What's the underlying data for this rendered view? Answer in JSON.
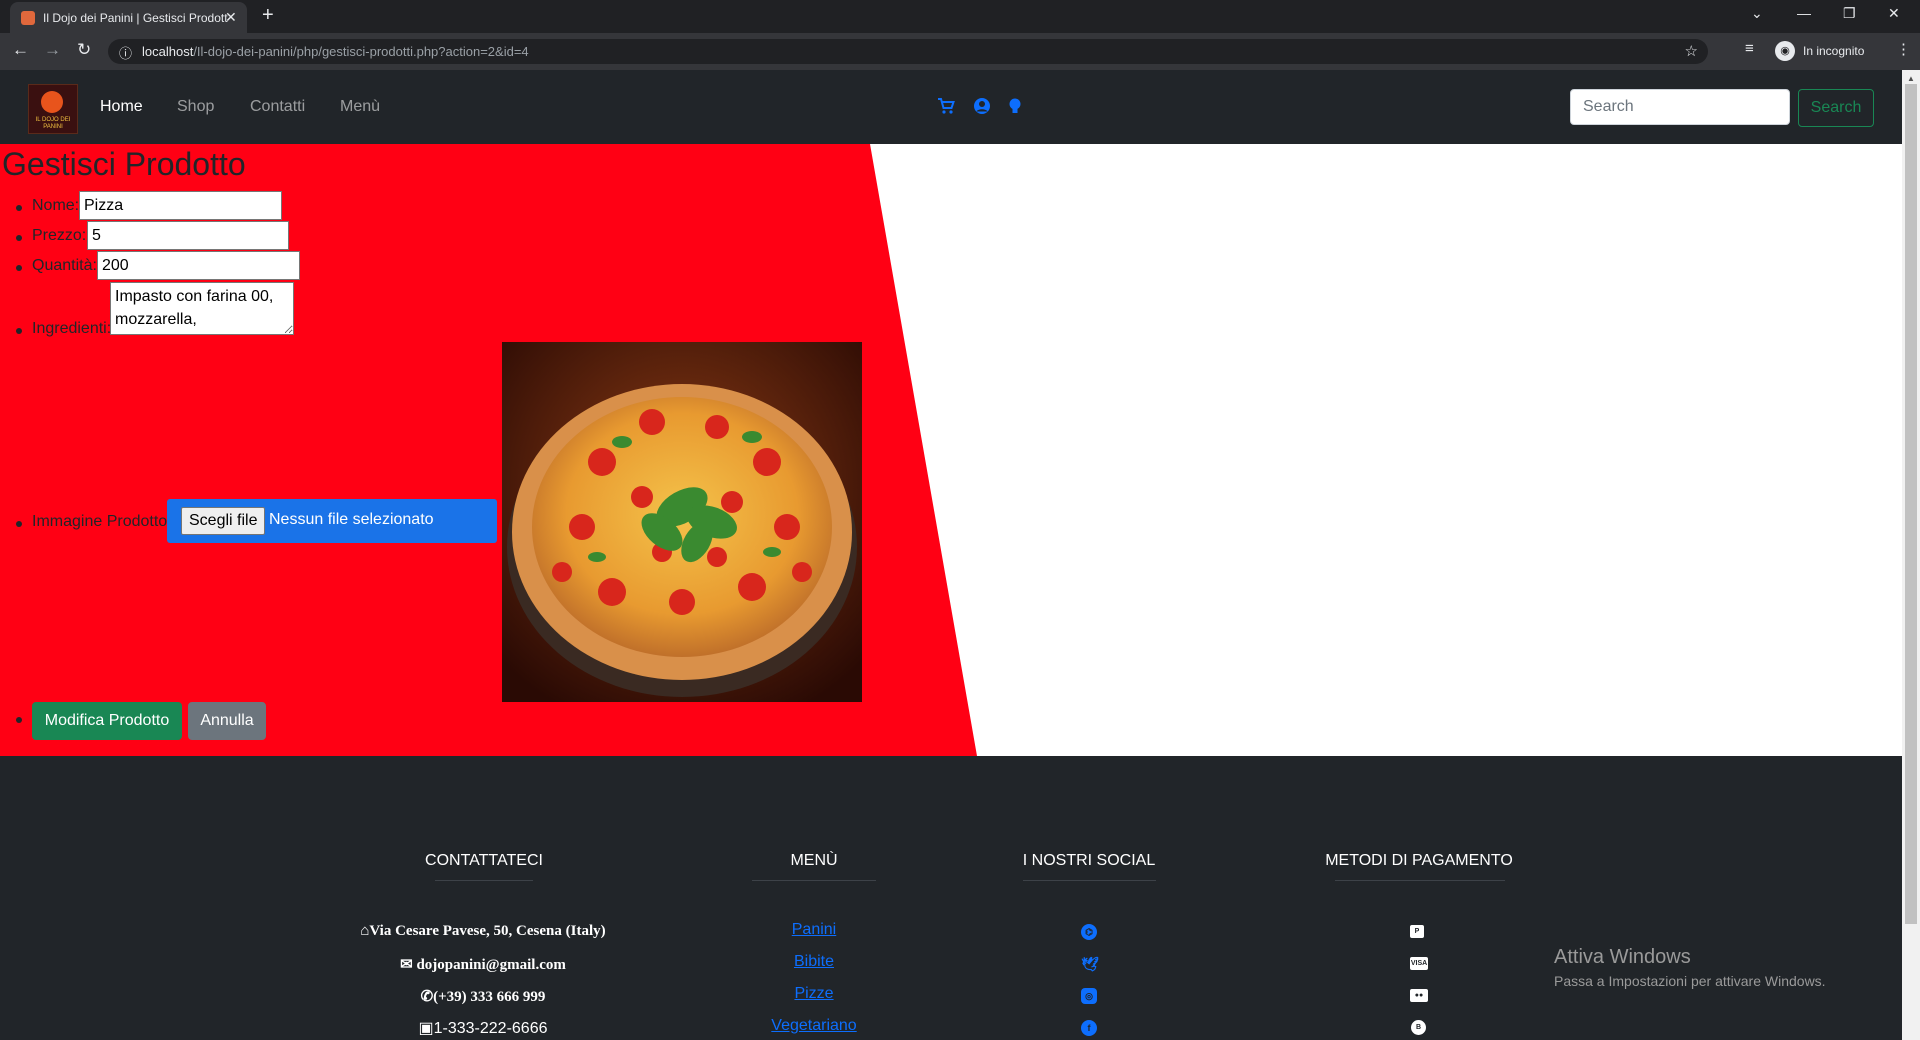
{
  "browser": {
    "tab_title": "Il Dojo dei Panini | Gestisci Prodotto",
    "new_tab": "+",
    "url_host": "localhost",
    "url_path": "/Il-dojo-dei-panini/php/gestisci-prodotti.php?action=2&id=4",
    "incognito_label": "In incognito"
  },
  "navbar": {
    "logo_text": "IL DOJO DEI PANINI",
    "links": [
      "Home",
      "Shop",
      "Contatti",
      "Menù"
    ],
    "search_placeholder": "Search",
    "search_button": "Search"
  },
  "form": {
    "title": "Gestisci Prodotto",
    "nome_label": "Nome:",
    "nome_value": "Pizza",
    "prezzo_label": "Prezzo:",
    "prezzo_value": "5",
    "quantita_label": "Quantità:",
    "quantita_value": "200",
    "ingredienti_label": "Ingredienti:",
    "ingredienti_value": "Impasto con farina 00, mozzarella,",
    "immagine_label": "Immagine Prodotto:",
    "file_button": "Scegli file",
    "file_status": "Nessun file selezionato",
    "modifica_button": "Modifica Prodotto",
    "annulla_button": "Annulla"
  },
  "footer": {
    "headings": [
      "CONTATTATECI",
      "MENÙ",
      "I NOSTRI SOCIAL",
      "METODI DI PAGAMENTO"
    ],
    "address": "Via Cesare Pavese, 50, Cesena (Italy)",
    "email": "dojopanini@gmail.com",
    "phone": "(+39) 333 666 999",
    "fax": "1-333-222-6666",
    "menu_links": [
      "Panini",
      "Bibite",
      "Pizze",
      "Vegetariano"
    ],
    "socials": [
      "github-icon",
      "twitter-icon",
      "instagram-icon",
      "facebook-icon"
    ],
    "payments": [
      "paypal-icon",
      "visa-icon",
      "mastercard-icon",
      "bitcoin-icon"
    ]
  },
  "windows_watermark": {
    "title": "Attiva Windows",
    "subtitle": "Passa a Impostazioni per attivare Windows."
  },
  "colors": {
    "form_background": "#ff0014",
    "navbar": "#212529",
    "footer": "#212529",
    "accent_blue": "#0d6efd",
    "success_green": "#198754"
  }
}
